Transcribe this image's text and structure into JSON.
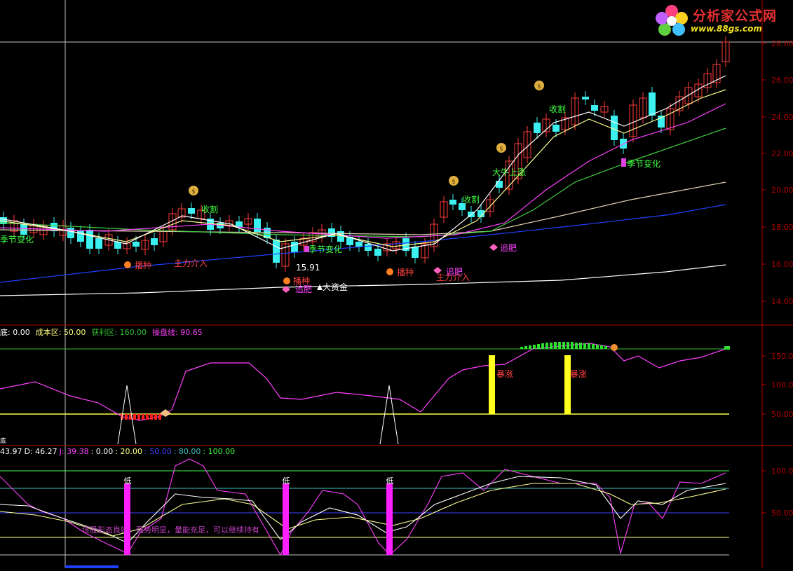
{
  "logo": {
    "title": "分析家公式网",
    "url": "www.88gs.com"
  },
  "colors": {
    "bg": "#000000",
    "axis": "#b00000",
    "up": "#ff3c3c",
    "down": "#3cf0f0",
    "ma_white": "#ffffff",
    "ma_yellow": "#ffff90",
    "ma_magenta": "#ff40ff",
    "ma_green": "#40d040",
    "ma_tan": "#e0d0b0",
    "ma_blue": "#2040ff",
    "label_red": "#ff4040",
    "label_green": "#40ff40",
    "label_magenta": "#ff40ff"
  },
  "price_axis": {
    "labels": [
      "28.00",
      "26.00",
      "24.00",
      "22.00",
      "20.00",
      "18.00",
      "16.00",
      "14.00"
    ]
  },
  "price_annotations": [
    {
      "text": "收割",
      "color": "#40ff40"
    },
    {
      "text": "收割",
      "color": "#40ff40"
    },
    {
      "text": "收割",
      "color": "#40ff40"
    },
    {
      "text": "季节变化",
      "color": "#40ff40"
    },
    {
      "text": "季节变化",
      "color": "#40ff40"
    },
    {
      "text": "季节变化",
      "color": "#40ff40"
    },
    {
      "text": "播种",
      "color": "#ff4040"
    },
    {
      "text": "播种",
      "color": "#ff4040"
    },
    {
      "text": "播种",
      "color": "#ff4040"
    },
    {
      "text": "主力介入",
      "color": "#ff4040"
    },
    {
      "text": "主力介入",
      "color": "#ff4040"
    },
    {
      "text": "追肥",
      "color": "#ff40ff"
    },
    {
      "text": "追肥",
      "color": "#ff40ff"
    },
    {
      "text": "追肥",
      "color": "#ff40ff"
    },
    {
      "text": "大资金",
      "color": "#ffffff"
    },
    {
      "text": "大牛上涨",
      "color": "#40ff40"
    },
    {
      "text": "15.91",
      "color": "#ffffff"
    },
    {
      "text": "低",
      "color": "#ffffff"
    }
  ],
  "panel2": {
    "legend": [
      {
        "text": "底: 0.00",
        "color": "#ffffff"
      },
      {
        "text": "成本区: 50.00",
        "color": "#ffff80"
      },
      {
        "text": "获利区: 160.00",
        "color": "#30c030"
      },
      {
        "text": "操盘线: 90.65",
        "color": "#ff40ff"
      }
    ],
    "axis": [
      "150.00",
      "100.00",
      "50.00"
    ],
    "labels": [
      {
        "text": "暴涨",
        "color": "#ff4040"
      },
      {
        "text": "暴涨",
        "color": "#ff4040"
      }
    ],
    "corner": "底"
  },
  "panel3": {
    "legend": [
      {
        "text": "43.97",
        "color": "#ffffff"
      },
      {
        "text": "D: 46.27",
        "color": "#ffffff"
      },
      {
        "text": "J: 39.38",
        "color": "#ff40ff"
      },
      {
        "text": ": 0.00",
        "color": "#ffffff"
      },
      {
        "text": ": 20.00",
        "color": "#ffff80"
      },
      {
        "text": ": 50.00",
        "color": "#4040ff"
      },
      {
        "text": ": 80.00",
        "color": "#40c0c0"
      },
      {
        "text": ": 100.00",
        "color": "#40ff40"
      }
    ],
    "axis": [
      "100.00",
      "50.00"
    ],
    "low_labels": [
      "低",
      "低",
      "低"
    ],
    "note": "该股形态良好，强势明显，量能充足，可以继续持有"
  }
}
